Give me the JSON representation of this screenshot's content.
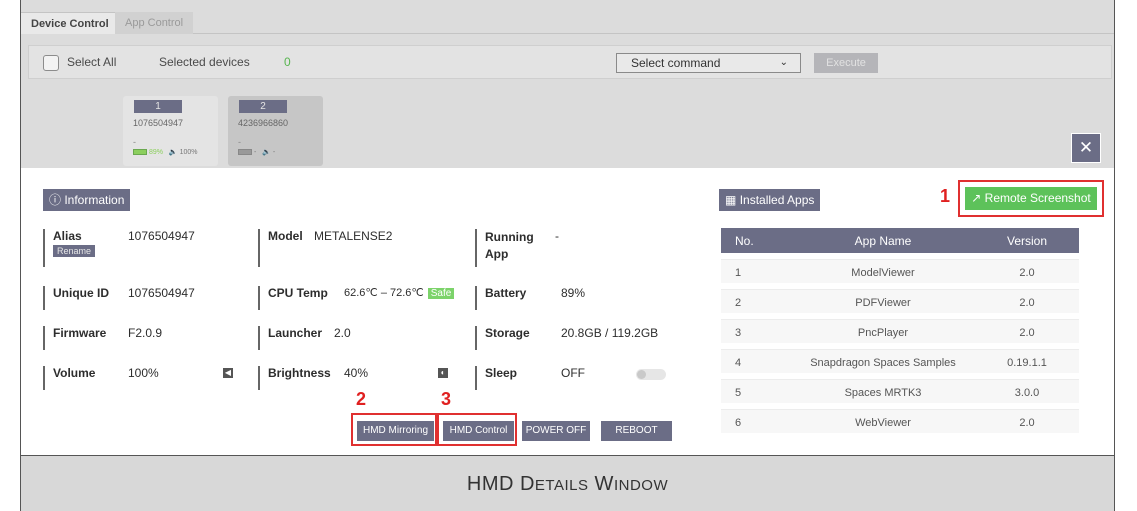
{
  "tabs": [
    {
      "label": "Device Control"
    },
    {
      "label": "App Control"
    }
  ],
  "command_bar": {
    "select_all": "Select All",
    "selected_devices": "Selected devices",
    "selected_count": "0",
    "select_command": "Select command",
    "execute": "Execute"
  },
  "devices": [
    {
      "num": "1",
      "id": "1076504947",
      "dash": "-",
      "battery": "89%",
      "volume": "100%"
    },
    {
      "num": "2",
      "id": "4236966860",
      "dash": "-",
      "battery": "-",
      "volume": "-"
    }
  ],
  "modal": {
    "close_glyph": "✕",
    "information_label": "ⓘ Information",
    "installed_apps_label": "Installed Apps",
    "remote_screenshot": "Remote Screenshot",
    "info": {
      "alias_label": "Alias",
      "alias_value": "1076504947",
      "rename": "Rename",
      "model_label": "Model",
      "model_value": "METALENSE2",
      "running_app_label": "Running App",
      "running_app_value": "-",
      "unique_id_label": "Unique ID",
      "unique_id_value": "1076504947",
      "cpu_temp_label": "CPU Temp",
      "cpu_temp_value": "62.6℃ – 72.6℃",
      "cpu_temp_status": "Safe",
      "battery_label": "Battery",
      "battery_value": "89%",
      "firmware_label": "Firmware",
      "firmware_value": "F2.0.9",
      "launcher_label": "Launcher",
      "launcher_value": "2.0",
      "storage_label": "Storage",
      "storage_value": "20.8GB / 119.2GB",
      "volume_label": "Volume",
      "volume_value": "100%",
      "brightness_label": "Brightness",
      "brightness_value": "40%",
      "sleep_label": "Sleep",
      "sleep_value": "OFF"
    },
    "actions": {
      "hmd_mirroring": "HMD Mirroring",
      "hmd_control": "HMD Control",
      "power_off": "POWER OFF",
      "reboot": "REBOOT"
    },
    "markers": [
      "1",
      "2",
      "3"
    ],
    "apps_table": {
      "headers": [
        "No.",
        "App Name",
        "Version"
      ],
      "rows": [
        {
          "no": "1",
          "name": "ModelViewer",
          "version": "2.0"
        },
        {
          "no": "2",
          "name": "PDFViewer",
          "version": "2.0"
        },
        {
          "no": "3",
          "name": "PncPlayer",
          "version": "2.0"
        },
        {
          "no": "4",
          "name": "Snapdragon Spaces Samples",
          "version": "0.19.1.1"
        },
        {
          "no": "5",
          "name": "Spaces MRTK3",
          "version": "3.0.0"
        },
        {
          "no": "6",
          "name": "WebViewer",
          "version": "2.0"
        }
      ]
    }
  },
  "footer": {
    "title_first": "HMD D",
    "title_sc1": "ETAILS",
    "title_mid": " W",
    "title_sc2": "INDOW"
  },
  "colors": {
    "accent": "#6b6d86",
    "success": "#5dc25a",
    "highlight": "#e03030"
  }
}
